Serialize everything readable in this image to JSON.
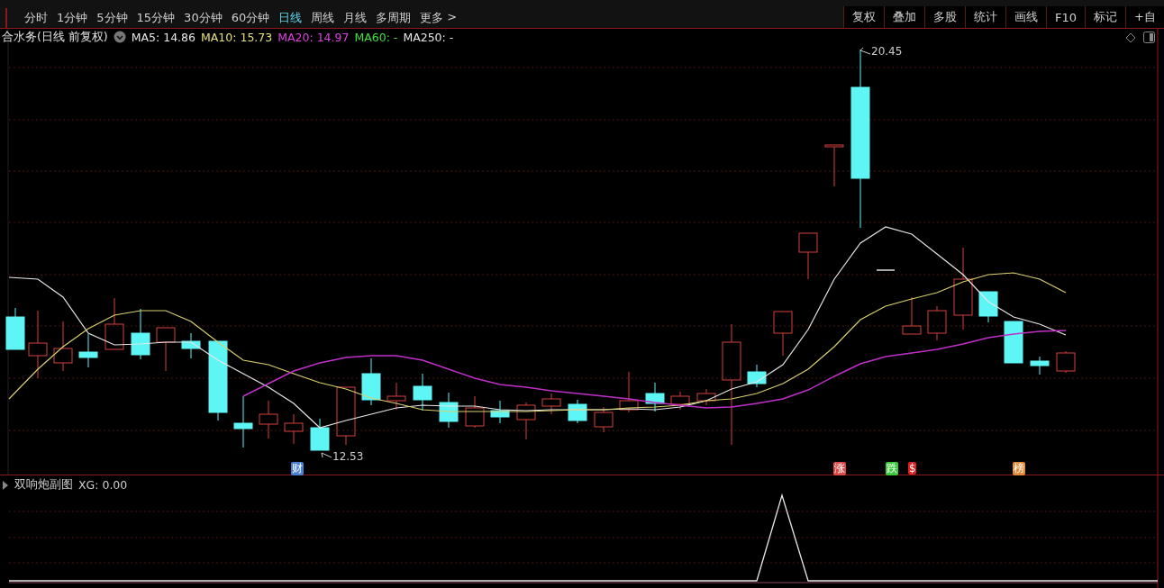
{
  "timeframe_tabs": [
    {
      "label": "分时",
      "selected": false
    },
    {
      "label": "1分钟",
      "selected": false
    },
    {
      "label": "5分钟",
      "selected": false
    },
    {
      "label": "15分钟",
      "selected": false
    },
    {
      "label": "30分钟",
      "selected": false
    },
    {
      "label": "60分钟",
      "selected": false
    },
    {
      "label": "日线",
      "selected": true
    },
    {
      "label": "周线",
      "selected": false
    },
    {
      "label": "月线",
      "selected": false
    },
    {
      "label": "多周期",
      "selected": false
    }
  ],
  "more_menu": {
    "label": "更多",
    "chevron": ">"
  },
  "toolbar_buttons": [
    "复权",
    "叠加",
    "多股",
    "统计",
    "画线",
    "F10",
    "标记",
    "+自"
  ],
  "chart": {
    "title": "合水务(日线 前复权)",
    "ma_legend": [
      {
        "label": "MA5: 14.86",
        "color": "#e6e6e6"
      },
      {
        "label": "MA10: 15.73",
        "color": "#e6e07a"
      },
      {
        "label": "MA20: 14.97",
        "color": "#e040e0"
      },
      {
        "label": "MA60: -",
        "color": "#40e040"
      },
      {
        "label": "MA250: -",
        "color": "#e6e6e6"
      }
    ],
    "high_label": "20.45",
    "low_label": "12.53",
    "event_markers": [
      {
        "label": "财",
        "color": "#4a7fd0"
      },
      {
        "label": "涨",
        "color": "#e04848"
      },
      {
        "label": "跌",
        "color": "#3cc83c"
      },
      {
        "label": "$",
        "color": "#e02020"
      },
      {
        "label": "榜",
        "color": "#e08a3c"
      }
    ]
  },
  "indicator_panel": {
    "title": "双响炮副图",
    "reading": "XG: 0.00"
  }
}
